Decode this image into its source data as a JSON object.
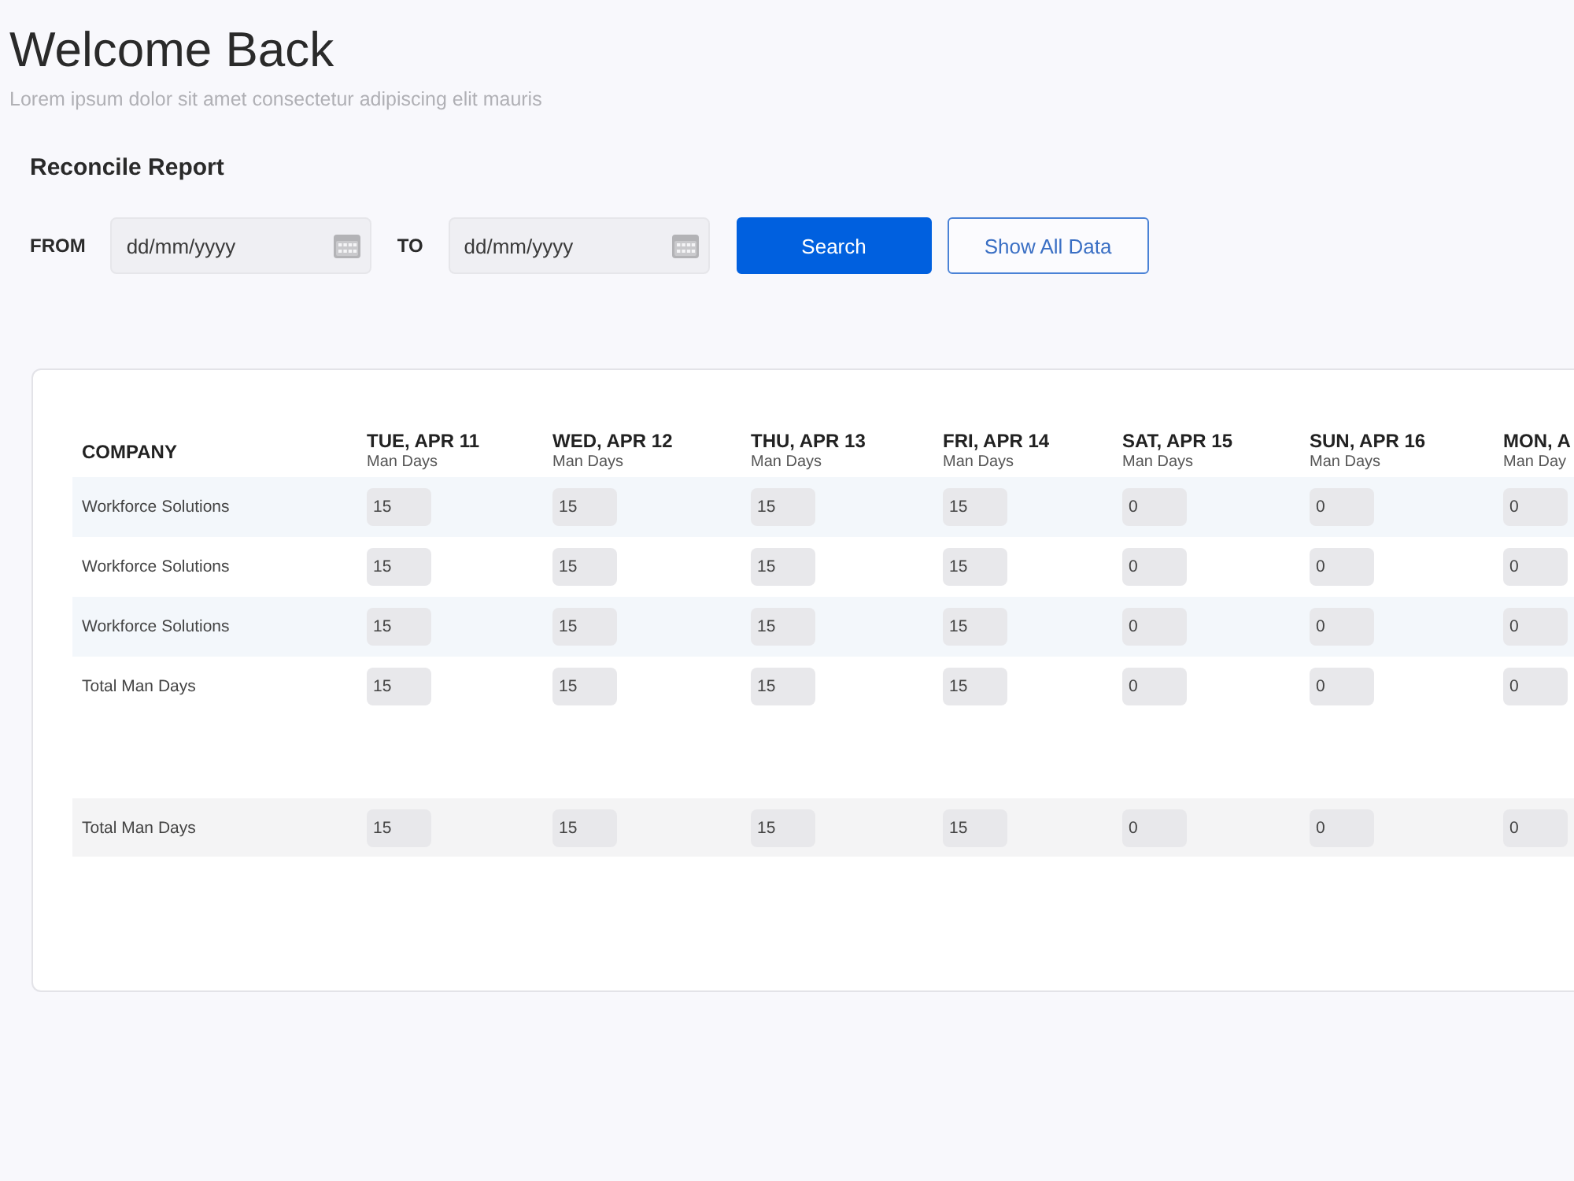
{
  "header": {
    "title": "Welcome Back",
    "subtitle": "Lorem ipsum dolor sit amet consectetur adipiscing elit mauris"
  },
  "report": {
    "title": "Reconcile Report",
    "filters": [
      {
        "label": "FROM",
        "placeholder": "dd/mm/yyyy"
      },
      {
        "label": "TO",
        "placeholder": "dd/mm/yyyy"
      }
    ],
    "buttons": [
      {
        "label": "Search",
        "kind": "primary"
      },
      {
        "label": "Show All Data",
        "kind": "outline"
      }
    ]
  },
  "table": {
    "columns": [
      {
        "label": "COMPANY"
      },
      {
        "label": "TUE, APR 11",
        "sublabel": "Man Days"
      },
      {
        "label": "WED, APR 12",
        "sublabel": "Man Days"
      },
      {
        "label": "THU, APR 13",
        "sublabel": "Man Days"
      },
      {
        "label": "FRI, APR 14",
        "sublabel": "Man Days"
      },
      {
        "label": "SAT, APR 15",
        "sublabel": "Man Days"
      },
      {
        "label": "SUN, APR 16",
        "sublabel": "Man Days"
      },
      {
        "label": "MON, A",
        "sublabel": "Man Day"
      }
    ],
    "rows": [
      {
        "name": "Workforce Solutions",
        "values": [
          "15",
          "15",
          "15",
          "15",
          "0",
          "0",
          "0"
        ]
      },
      {
        "name": "Workforce Solutions",
        "values": [
          "15",
          "15",
          "15",
          "15",
          "0",
          "0",
          "0"
        ]
      },
      {
        "name": "Workforce Solutions",
        "values": [
          "15",
          "15",
          "15",
          "15",
          "0",
          "0",
          "0"
        ]
      },
      {
        "name": "Total Man Days",
        "values": [
          "15",
          "15",
          "15",
          "15",
          "0",
          "0",
          "0"
        ]
      }
    ],
    "footer": {
      "name": "Total Man Days",
      "values": [
        "15",
        "15",
        "15",
        "15",
        "0",
        "0",
        "0"
      ]
    }
  }
}
